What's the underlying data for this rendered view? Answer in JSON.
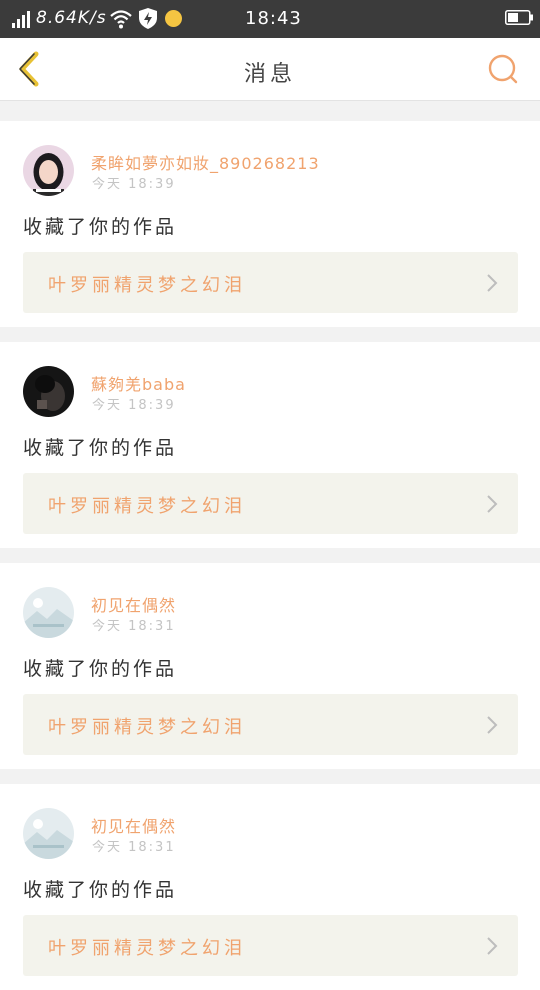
{
  "status_bar": {
    "speed": "8.64K/s",
    "time": "18:43",
    "icons": [
      "signal-icon",
      "wifi-icon",
      "shield-charging-icon",
      "yellow-dot-icon",
      "battery-icon"
    ]
  },
  "header": {
    "title": "消息",
    "back_icon": "chevron-left-icon",
    "search_icon": "search-icon",
    "accent": "#f0a36e"
  },
  "messages": [
    {
      "user": "柔眸如夢亦如妝_890268213",
      "time": "今天 18:39",
      "text": "收藏了你的作品",
      "work": "叶罗丽精灵梦之幻泪",
      "avatar": "girl-photo-avatar"
    },
    {
      "user": "蘇夠羌baba",
      "time": "今天 18:39",
      "text": "收藏了你的作品",
      "work": "叶罗丽精灵梦之幻泪",
      "avatar": "dark-photo-avatar"
    },
    {
      "user": "初见在偶然",
      "time": "今天 18:31",
      "text": "收藏了你的作品",
      "work": "叶罗丽精灵梦之幻泪",
      "avatar": "default-landscape-avatar"
    },
    {
      "user": "初见在偶然",
      "time": "今天 18:31",
      "text": "收藏了你的作品",
      "work": "叶罗丽精灵梦之幻泪",
      "avatar": "default-landscape-avatar"
    }
  ]
}
